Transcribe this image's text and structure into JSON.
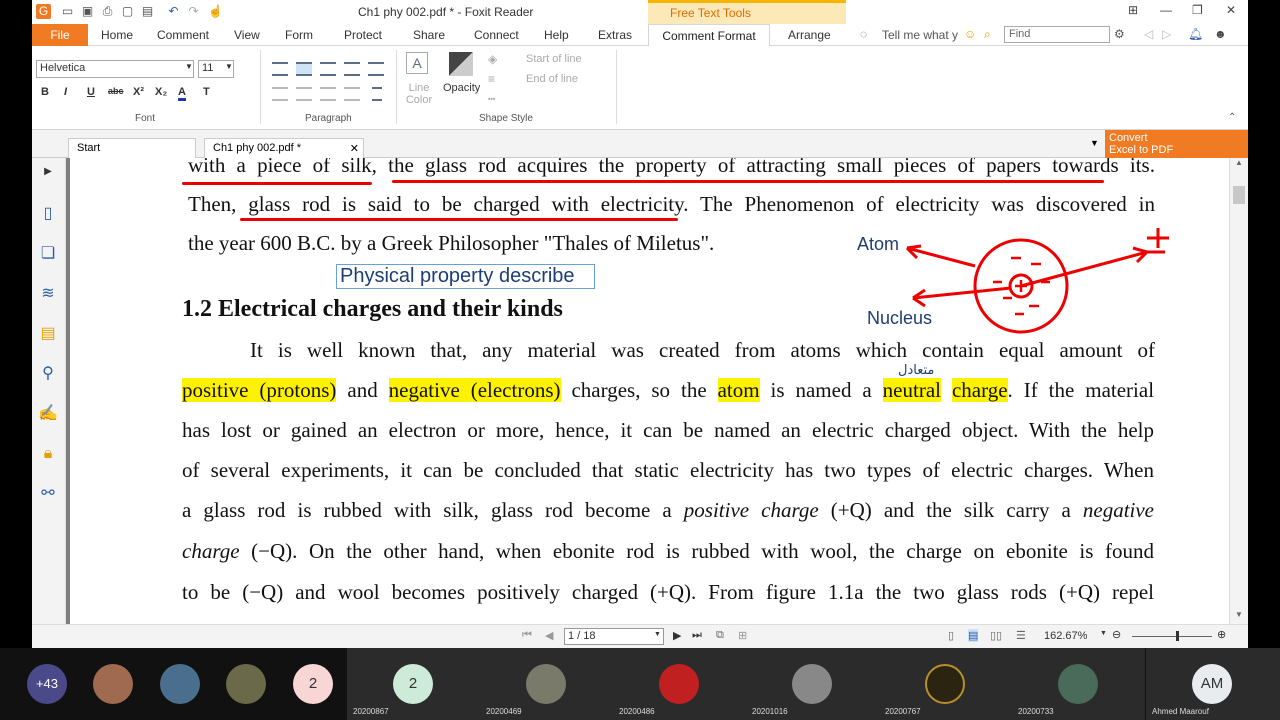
{
  "window": {
    "title": "Ch1     phy     002.pdf * - Foxit Reader",
    "context_tab_title": "Free Text Tools"
  },
  "ribbon_tabs": [
    "File",
    "Home",
    "Comment",
    "View",
    "Form",
    "Protect",
    "Share",
    "Connect",
    "Help",
    "Extras",
    "Comment Format",
    "Arrange"
  ],
  "tell_me": "Tell me what y",
  "find_placeholder": "Find",
  "ribbon": {
    "font_name": "Helvetica",
    "font_size": "11",
    "format_buttons": [
      "B",
      "I",
      "U",
      "abc",
      "X²",
      "X₂",
      "A",
      "T"
    ],
    "group_font": "Font",
    "group_paragraph": "Paragraph",
    "group_shape_style": "Shape Style",
    "line_color": "Line Color",
    "opacity": "Opacity",
    "start_of_line": "Start of line",
    "end_of_line": "End of line"
  },
  "doc_tabs": [
    "Start",
    "Ch1     phy     002.pdf *"
  ],
  "convert": {
    "line1": "Convert",
    "line2": "Excel to PDF"
  },
  "document": {
    "line1_a": "with a piece of silk",
    "line1_b": ", the glass rod acquires the property of attracting small pieces of papers towards its.",
    "line2_a": "Then, ",
    "line2_b": "glass rod is said to be charged with electricity",
    "line2_c": ". The Phenomenon of electricity was discovered in",
    "line3": "the year 600 B.C. by a Greek Philosopher \"Thales of Miletus\".",
    "free_text": "Physical property describe",
    "heading": "1.2 Electrical charges and their kinds",
    "p1": "It is well known that, any material was created from atoms which contain equal amount of",
    "p2_hl1": "positive (protons)",
    "p2_t1": " and ",
    "p2_hl2": "negative (electrons)",
    "p2_t2": " charges, so the ",
    "p2_hl3": "atom",
    "p2_t3": " is named a ",
    "p2_hl4": "neutral",
    "p2_t4": " ",
    "p2_hl5": "charge",
    "p2_t5": ". If the material",
    "p3": "has lost or gained an electron or more, hence, it can be named an electric charged object. With the help",
    "p4": "of several experiments, it can be concluded that static electricity has two types of electric charges. When",
    "p5_a": "a glass rod is rubbed with silk, glass rod become a ",
    "p5_b": "positive charge",
    "p5_c": " (+Q) and the silk carry a ",
    "p5_d": "negative",
    "p6_a": "charge",
    "p6_b": " (−Q). On the other hand, when ebonite rod is rubbed with wool, the charge on ebonite is found",
    "p7": "to be (−Q) and wool becomes positively charged (+Q). From figure 1.1a the two glass rods (+Q) repel",
    "arabic_note": "متعادل",
    "diagram_atom": "Atom",
    "diagram_nucleus": "Nucleus"
  },
  "status": {
    "page": "1 / 18",
    "zoom": "162.67%"
  },
  "meeting": {
    "more_count": "+43",
    "tiles": [
      {
        "badge": "2",
        "name": ""
      },
      {
        "badge": "2",
        "name": "20200867"
      },
      {
        "badge": "",
        "name": "20200469"
      },
      {
        "badge": "",
        "name": "20200486"
      },
      {
        "badge": "",
        "name": "20201016"
      },
      {
        "badge": "",
        "name": "20200767"
      },
      {
        "badge": "",
        "name": "20200733"
      },
      {
        "badge": "AM",
        "name": "Ahmed Maarouf"
      }
    ]
  },
  "colors": {
    "accent": "#f07b22",
    "highlight": "#fff200",
    "annotation_red": "#e00000"
  }
}
